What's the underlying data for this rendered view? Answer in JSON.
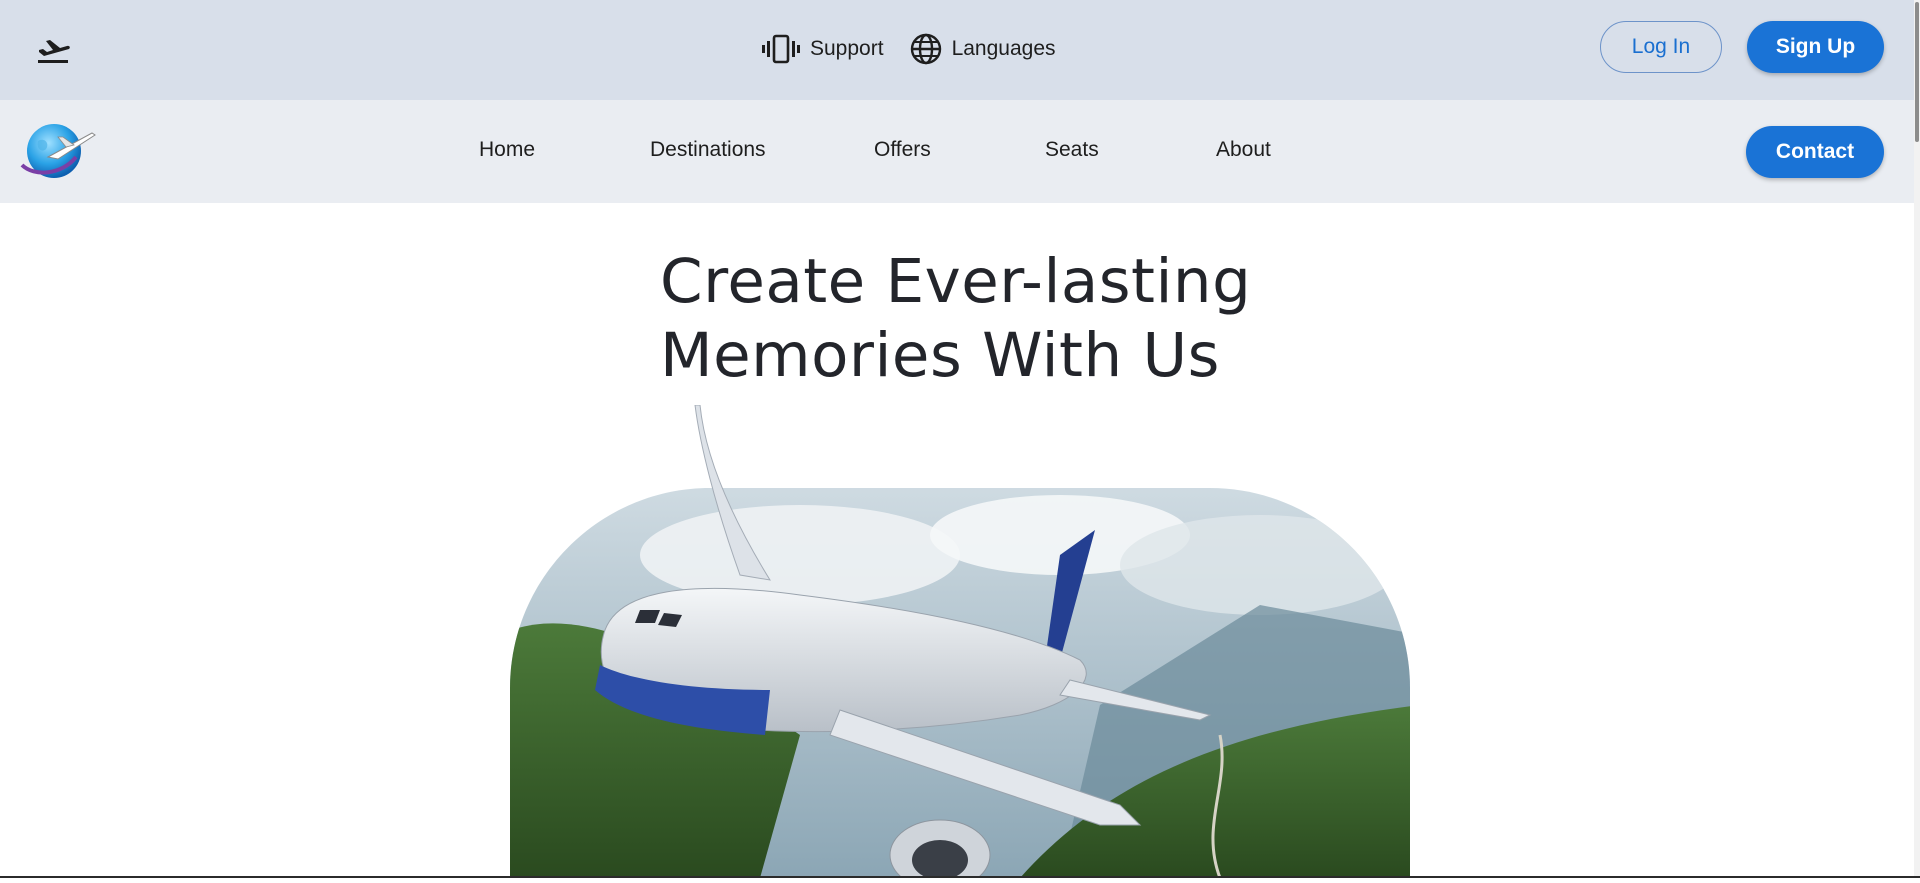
{
  "topbar": {
    "departure_icon": "airplane-departure-icon",
    "support_label": "Support",
    "support_icon": "phone-vibrate-icon",
    "languages_label": "Languages",
    "languages_icon": "globe-icon",
    "login_label": "Log In",
    "signup_label": "Sign Up"
  },
  "navbar": {
    "logo_icon": "globe-airplane-logo",
    "items": [
      {
        "label": "Home"
      },
      {
        "label": "Destinations"
      },
      {
        "label": "Offers"
      },
      {
        "label": "Seats"
      },
      {
        "label": "About"
      }
    ],
    "contact_label": "Contact"
  },
  "hero": {
    "title_line1": "Create Ever-lasting",
    "title_line2": "Memories With Us",
    "image": "airplane-over-mountain-valley"
  },
  "colors": {
    "topbar_bg": "#d8dfea",
    "navbar_bg": "#eaedf2",
    "accent": "#1a73d6",
    "text": "#1e1e1e"
  }
}
